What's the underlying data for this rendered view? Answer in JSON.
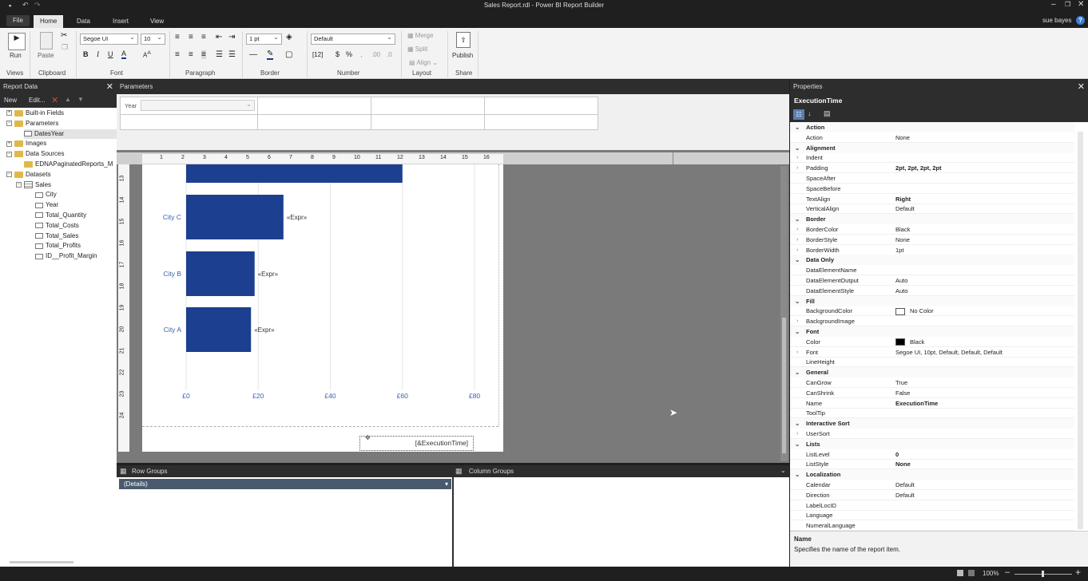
{
  "window": {
    "title": "Sales Report.rdl - Power BI Report Builder",
    "user": "sue bayes"
  },
  "tabs": [
    "File",
    "Home",
    "Data",
    "Insert",
    "View"
  ],
  "ribbon": {
    "run": "Run",
    "paste": "Paste",
    "font_name": "Segoe UI",
    "font_size": "10",
    "border_width": "1 pt",
    "number_format": "Default",
    "merge": "Merge",
    "split": "Split",
    "align": "Align",
    "publish": "Publish",
    "groups": {
      "views": "Views",
      "clipboard": "Clipboard",
      "font": "Font",
      "paragraph": "Paragraph",
      "border": "Border",
      "number": "Number",
      "layout": "Layout",
      "share": "Share"
    }
  },
  "report_data": {
    "title": "Report Data",
    "toolbar": {
      "new": "New",
      "edit": "Edit..."
    },
    "tree": [
      {
        "label": "Built-in Fields",
        "kind": "folder",
        "exp": "+"
      },
      {
        "label": "Parameters",
        "kind": "folder",
        "exp": "-"
      },
      {
        "label": "DatesYear",
        "kind": "param"
      },
      {
        "label": "Images",
        "kind": "folder",
        "exp": "+"
      },
      {
        "label": "Data Sources",
        "kind": "folder",
        "exp": "-"
      },
      {
        "label": "EDNAPaginatedReports_M",
        "kind": "source"
      },
      {
        "label": "Datasets",
        "kind": "folder",
        "exp": "-"
      },
      {
        "label": "Sales",
        "kind": "table",
        "exp": "-"
      },
      {
        "label": "City",
        "kind": "field"
      },
      {
        "label": "Year",
        "kind": "field"
      },
      {
        "label": "Total_Quantity",
        "kind": "field"
      },
      {
        "label": "Total_Costs",
        "kind": "field"
      },
      {
        "label": "Total_Sales",
        "kind": "field"
      },
      {
        "label": "Total_Profits",
        "kind": "field"
      },
      {
        "label": "ID__Profit_Margin",
        "kind": "field"
      }
    ]
  },
  "parameters": {
    "title": "Parameters",
    "year_label": "Year"
  },
  "ruler": {
    "h": [
      "1",
      "2",
      "3",
      "4",
      "5",
      "6",
      "7",
      "8",
      "9",
      "10",
      "11",
      "12",
      "13",
      "14",
      "15",
      "16"
    ],
    "v": [
      "13",
      "14",
      "15",
      "16",
      "17",
      "18",
      "19",
      "20",
      "21",
      "22",
      "23",
      "24"
    ]
  },
  "chart_data": {
    "type": "bar",
    "orientation": "horizontal",
    "categories": [
      "City C",
      "City B",
      "City A"
    ],
    "values": [
      27,
      19,
      18
    ],
    "top_partial_value": 60,
    "data_label": "«Expr»",
    "x_ticks": [
      "£0",
      "£20",
      "£40",
      "£60",
      "£80"
    ],
    "xlim": [
      0,
      80
    ],
    "grid": true
  },
  "expression_box": "[&ExecutionTime]",
  "groups": {
    "row": "Row Groups",
    "column": "Column Groups",
    "details": "(Details)"
  },
  "properties": {
    "title": "Properties",
    "selected": "ExecutionTime",
    "rows": [
      {
        "t": "cat",
        "n": "Action"
      },
      {
        "t": "row",
        "n": "Action",
        "v": "None"
      },
      {
        "t": "cat",
        "n": "Alignment"
      },
      {
        "t": "row",
        "n": "Indent",
        "v": "",
        "e": true
      },
      {
        "t": "row",
        "n": "Padding",
        "v": "2pt, 2pt, 2pt, 2pt",
        "e": true,
        "b": true
      },
      {
        "t": "row",
        "n": "SpaceAfter",
        "v": ""
      },
      {
        "t": "row",
        "n": "SpaceBefore",
        "v": ""
      },
      {
        "t": "row",
        "n": "TextAlign",
        "v": "Right",
        "b": true
      },
      {
        "t": "row",
        "n": "VerticalAlign",
        "v": "Default"
      },
      {
        "t": "cat",
        "n": "Border"
      },
      {
        "t": "row",
        "n": "BorderColor",
        "v": "Black",
        "e": true
      },
      {
        "t": "row",
        "n": "BorderStyle",
        "v": "None",
        "e": true
      },
      {
        "t": "row",
        "n": "BorderWidth",
        "v": "1pt",
        "e": true
      },
      {
        "t": "cat",
        "n": "Data Only"
      },
      {
        "t": "row",
        "n": "DataElementName",
        "v": ""
      },
      {
        "t": "row",
        "n": "DataElementOutput",
        "v": "Auto"
      },
      {
        "t": "row",
        "n": "DataElementStyle",
        "v": "Auto"
      },
      {
        "t": "cat",
        "n": "Fill"
      },
      {
        "t": "row",
        "n": "BackgroundColor",
        "v": "No Color",
        "sw": "#ffffff"
      },
      {
        "t": "row",
        "n": "BackgroundImage",
        "v": "",
        "e": true
      },
      {
        "t": "cat",
        "n": "Font"
      },
      {
        "t": "row",
        "n": "Color",
        "v": "Black",
        "sw": "#000000"
      },
      {
        "t": "row",
        "n": "Font",
        "v": "Segoe UI, 10pt, Default, Default, Default",
        "e": true
      },
      {
        "t": "row",
        "n": "LineHeight",
        "v": ""
      },
      {
        "t": "cat",
        "n": "General"
      },
      {
        "t": "row",
        "n": "CanGrow",
        "v": "True"
      },
      {
        "t": "row",
        "n": "CanShrink",
        "v": "False"
      },
      {
        "t": "row",
        "n": "Name",
        "v": "ExecutionTime",
        "b": true
      },
      {
        "t": "row",
        "n": "ToolTip",
        "v": ""
      },
      {
        "t": "cat",
        "n": "Interactive Sort"
      },
      {
        "t": "row",
        "n": "UserSort",
        "v": "",
        "e": true
      },
      {
        "t": "cat",
        "n": "Lists"
      },
      {
        "t": "row",
        "n": "ListLevel",
        "v": "0",
        "b": true
      },
      {
        "t": "row",
        "n": "ListStyle",
        "v": "None",
        "b": true
      },
      {
        "t": "cat",
        "n": "Localization"
      },
      {
        "t": "row",
        "n": "Calendar",
        "v": "Default"
      },
      {
        "t": "row",
        "n": "Direction",
        "v": "Default"
      },
      {
        "t": "row",
        "n": "LabelLocID",
        "v": ""
      },
      {
        "t": "row",
        "n": "Language",
        "v": ""
      },
      {
        "t": "row",
        "n": "NumeralLanguage",
        "v": ""
      }
    ],
    "desc_title": "Name",
    "desc_text": "Specifies the name of the report item."
  },
  "status": {
    "zoom": "100%"
  }
}
